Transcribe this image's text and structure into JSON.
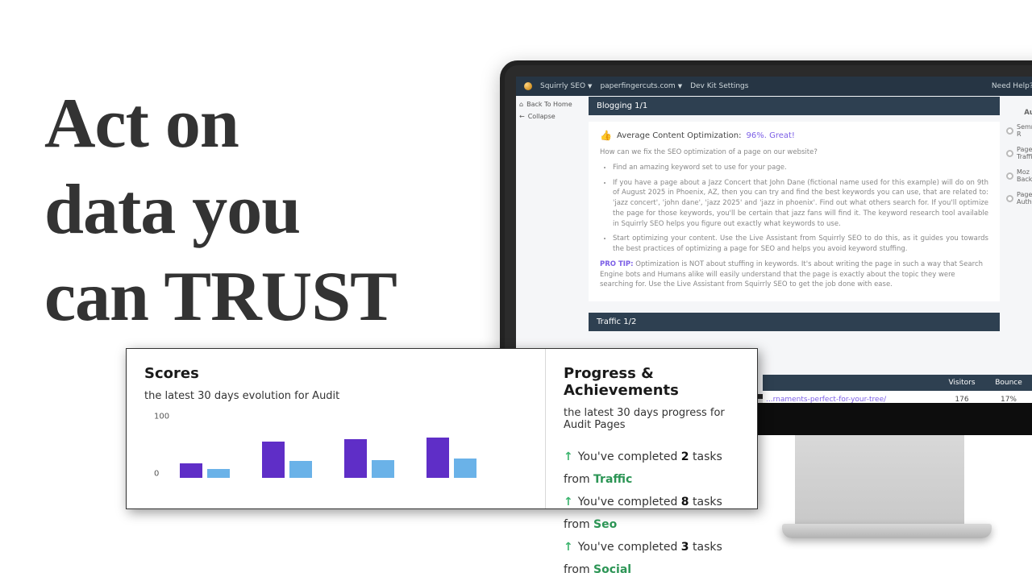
{
  "hero": {
    "line1": "Act on",
    "line2": "data you",
    "line3": "can TRUST"
  },
  "topbar": {
    "app": "Squirrly SEO",
    "domain": "paperfingercuts.com",
    "devkit": "Dev Kit Settings",
    "help": "Need Help?"
  },
  "nav": {
    "back": "Back To Home",
    "collapse": "Collapse"
  },
  "section1": {
    "title": "Blogging 1/1"
  },
  "content": {
    "avg_label": "Average Content Optimization:",
    "avg_value": "96%. Great!",
    "question": "How can we fix the SEO optimization of a page on our website?",
    "bullet1": "Find an amazing keyword set to use for your page.",
    "bullet2": "If you have a page about a Jazz Concert that John Dane (fictional name used for this example) will do on 9th of August 2025 in Phoenix, AZ, then you can try and find the best keywords you can use, that are related to: 'jazz concert', 'john dane', 'jazz 2025' and 'jazz in phoenix'. Find out what others search for. If you'll optimize the page for those keywords, you'll be certain that jazz fans will find it. The keyword research tool available in Squirrly SEO helps you figure out exactly what keywords to use.",
    "bullet3": "Start optimizing your content. Use the Live Assistant from Squirrly SEO to do this, as it guides you towards the best practices of optimizing a page for SEO and helps you avoid keyword stuffing.",
    "protip_label": "PRO TIP:",
    "protip": " Optimization is NOT about stuffing in keywords. It's about writing the page in such a way that Search Engine bots and Humans alike will easily understand that the page is exactly about the topic they were searching for. Use the Live Assistant from Squirrly SEO to get the job done with ease."
  },
  "section2": {
    "title": "Traffic 1/2"
  },
  "sidebar": {
    "title": "Audit",
    "items": [
      "Semrush R",
      "Page Traffic",
      "Moz Backli",
      "Page Auth"
    ]
  },
  "table": {
    "cols": [
      "",
      "Visitors",
      "Bounce"
    ],
    "row": {
      "url": "...rnaments-perfect-for-your-tree/",
      "visitors": "176",
      "bounce": "17%"
    }
  },
  "scores": {
    "title": "Scores",
    "subtitle": "the latest 30 days evolution for Audit"
  },
  "progress": {
    "title": "Progress & Achievements",
    "subtitle": "the latest 30 days progress for Audit Pages",
    "items": [
      {
        "prefix": "You've completed ",
        "count": "2",
        "mid": " tasks from ",
        "cat": "Traffic"
      },
      {
        "prefix": "You've completed ",
        "count": "8",
        "mid": " tasks from ",
        "cat": "Seo"
      },
      {
        "prefix": "You've completed ",
        "count": "3",
        "mid": " tasks from ",
        "cat": "Social"
      }
    ]
  },
  "chart_data": {
    "type": "bar",
    "title": "Scores — latest 30 days evolution for Audit",
    "xlabel": "",
    "ylabel": "",
    "ylim": [
      0,
      100
    ],
    "yticks": [
      0,
      100
    ],
    "categories": [
      "",
      "",
      "",
      ""
    ],
    "series": [
      {
        "name": "primary",
        "color": "#5f2ec7",
        "values": [
          26,
          64,
          68,
          72
        ]
      },
      {
        "name": "secondary",
        "color": "#6ab2e8",
        "values": [
          16,
          30,
          32,
          34
        ]
      }
    ]
  }
}
